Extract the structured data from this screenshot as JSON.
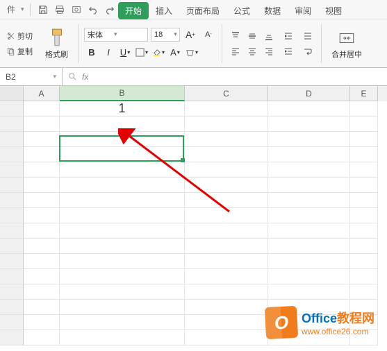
{
  "qat": {
    "file_suffix": "件"
  },
  "tabs": {
    "start": "开始",
    "insert": "插入",
    "layout": "页面布局",
    "formula": "公式",
    "data": "数据",
    "review": "审阅",
    "view": "视图"
  },
  "ribbon": {
    "cut": "剪切",
    "copy": "复制",
    "format_painter": "格式刷",
    "font_name": "宋体",
    "font_size": "18",
    "merge_center": "合并居中"
  },
  "namebox": "B2",
  "columns": [
    "A",
    "B",
    "C",
    "D",
    "E"
  ],
  "cell_B1": "1",
  "watermark": {
    "icon_letter": "O",
    "title_office": "Office",
    "title_rest": "教程网",
    "url": "www.office26.com"
  }
}
